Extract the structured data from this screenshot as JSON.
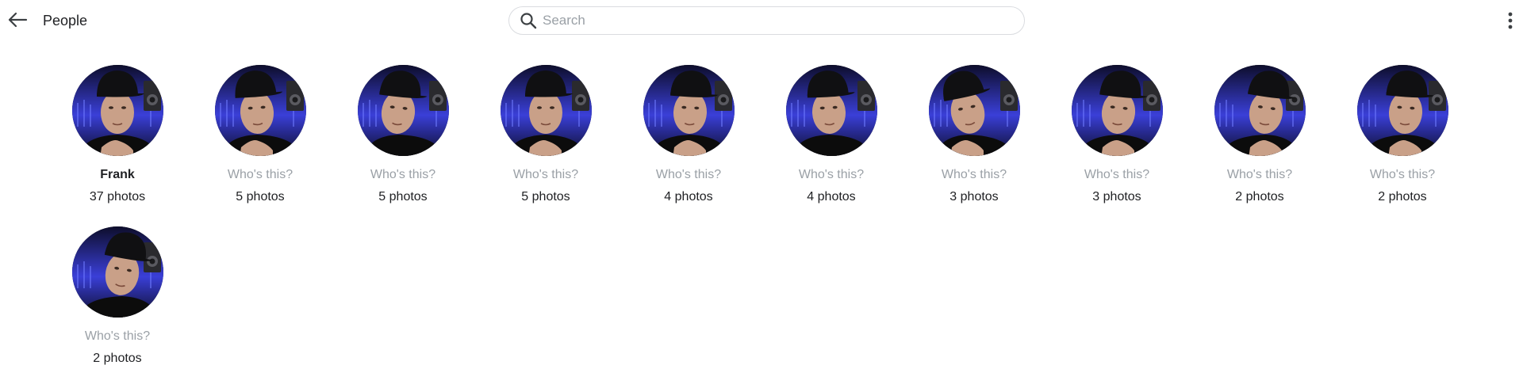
{
  "header": {
    "title": "People",
    "back_icon": "arrow-left-icon",
    "more_icon": "more-vert-icon"
  },
  "search": {
    "placeholder": "Search",
    "value": "",
    "icon": "search-icon"
  },
  "people": [
    {
      "name": "Frank",
      "count": "37 photos",
      "named": true
    },
    {
      "name": "Who's this?",
      "count": "5 photos",
      "named": false
    },
    {
      "name": "Who's this?",
      "count": "5 photos",
      "named": false
    },
    {
      "name": "Who's this?",
      "count": "5 photos",
      "named": false
    },
    {
      "name": "Who's this?",
      "count": "4 photos",
      "named": false
    },
    {
      "name": "Who's this?",
      "count": "4 photos",
      "named": false
    },
    {
      "name": "Who's this?",
      "count": "3 photos",
      "named": false
    },
    {
      "name": "Who's this?",
      "count": "3 photos",
      "named": false
    },
    {
      "name": "Who's this?",
      "count": "2 photos",
      "named": false
    },
    {
      "name": "Who's this?",
      "count": "2 photos",
      "named": false
    },
    {
      "name": "Who's this?",
      "count": "2 photos",
      "named": false
    }
  ],
  "colors": {
    "backdrop_blue": "#3a3fd8",
    "backdrop_dark": "#0d0d2a",
    "skin": "#c9a088",
    "cap": "#101012",
    "shirt": "#0c0c0c",
    "placeholder_text": "#9aa0a6",
    "text": "#202124"
  }
}
